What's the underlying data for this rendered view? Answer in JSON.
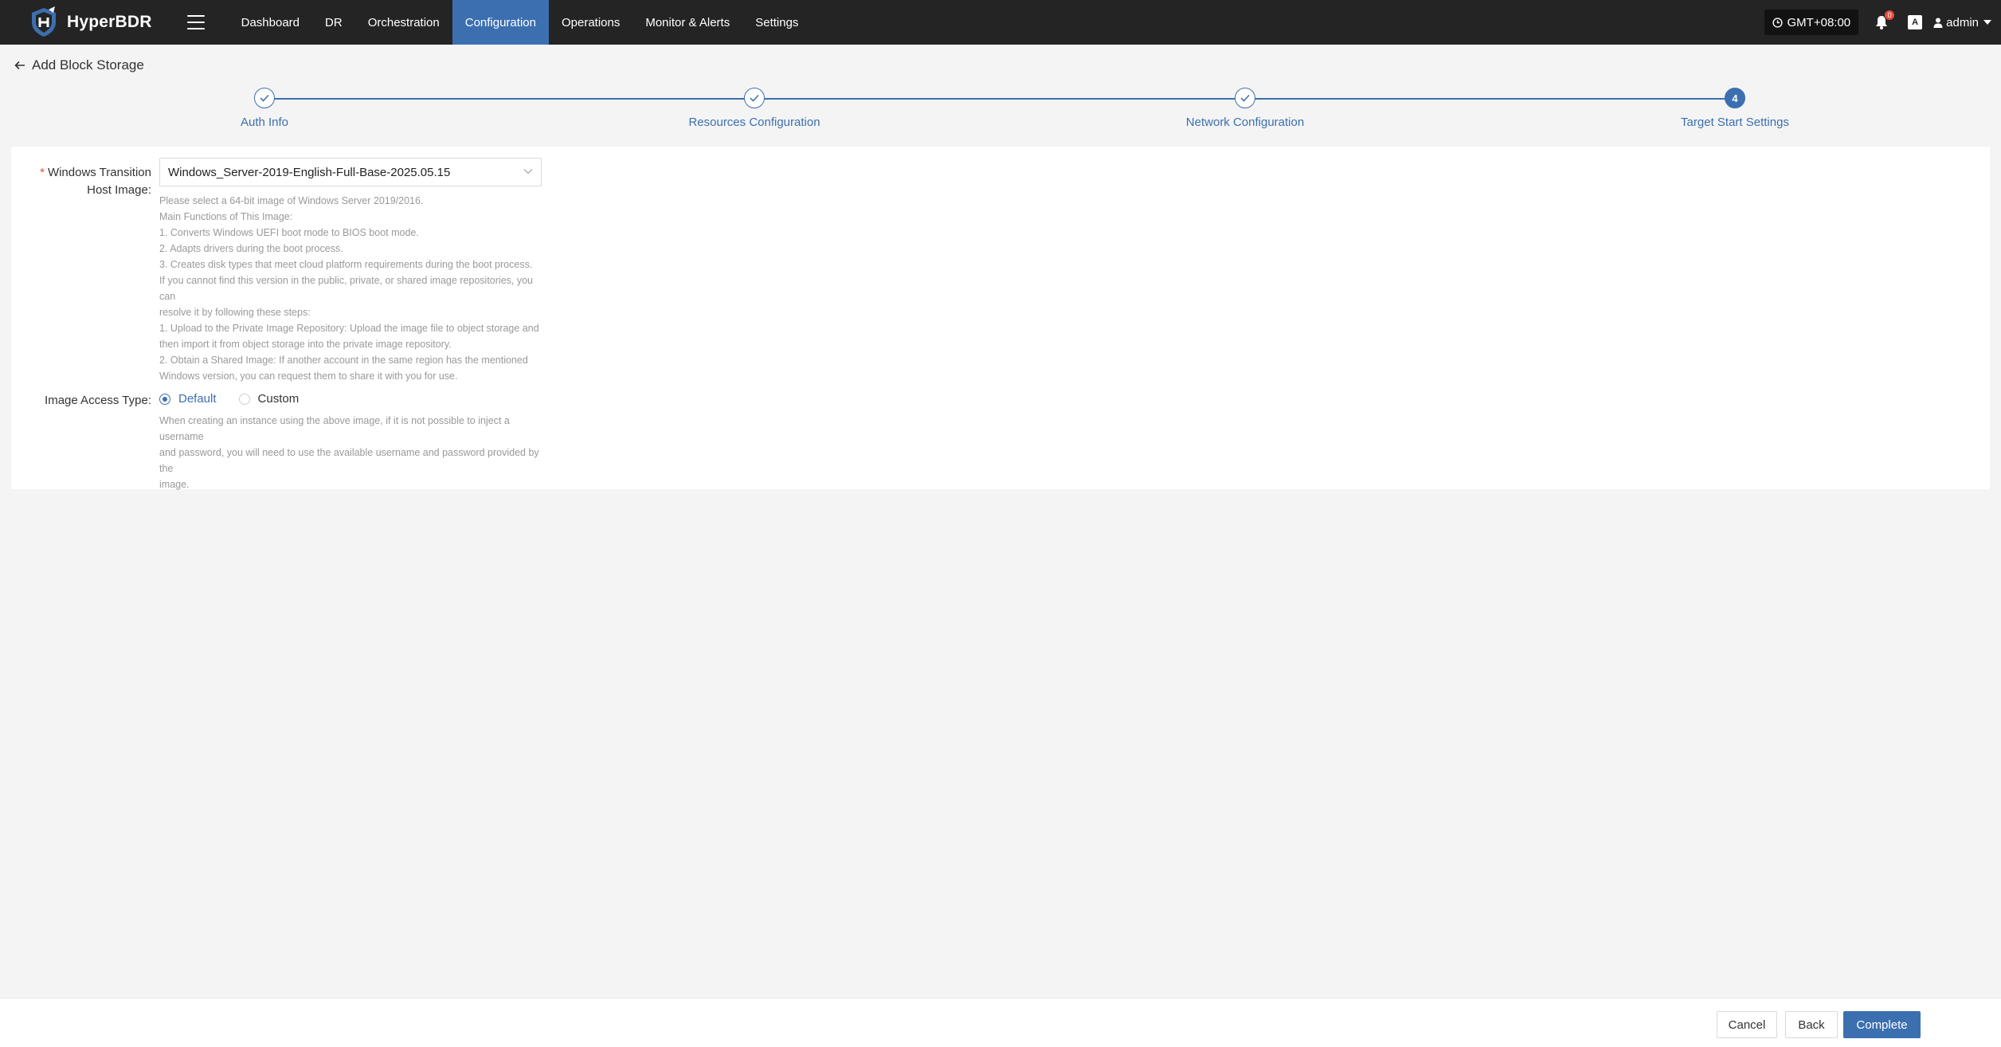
{
  "app": {
    "brand": "HyperBDR"
  },
  "nav": [
    {
      "label": "Dashboard",
      "active": false
    },
    {
      "label": "DR",
      "active": false
    },
    {
      "label": "Orchestration",
      "active": false
    },
    {
      "label": "Configuration",
      "active": true
    },
    {
      "label": "Operations",
      "active": false
    },
    {
      "label": "Monitor & Alerts",
      "active": false
    },
    {
      "label": "Settings",
      "active": false
    }
  ],
  "topbar": {
    "timezone": "GMT+08:00",
    "notification_count": "0",
    "lang_icon_text": "A",
    "user": "admin"
  },
  "page": {
    "title": "Add Block Storage"
  },
  "steps": [
    {
      "label": "Auth Info",
      "status": "done",
      "number": "1"
    },
    {
      "label": "Resources Configuration",
      "status": "done",
      "number": "2"
    },
    {
      "label": "Network Configuration",
      "status": "done",
      "number": "3"
    },
    {
      "label": "Target Start Settings",
      "status": "current",
      "number": "4"
    }
  ],
  "form": {
    "image_label_required": "*",
    "image_label_line1": "Windows Transition",
    "image_label_line2": "Host Image:",
    "image_value": "Windows_Server-2019-English-Full-Base-2025.05.15",
    "image_help": [
      "Please select a 64-bit image of Windows Server 2019/2016.",
      "Main Functions of This Image:",
      "1. Converts Windows UEFI boot mode to BIOS boot mode.",
      "2. Adapts drivers during the boot process.",
      "3. Creates disk types that meet cloud platform requirements during the boot process.",
      "If you cannot find this version in the public, private, or shared image repositories, you can",
      "resolve it by following these steps:",
      "1. Upload to the Private Image Repository: Upload the image file to object storage and",
      "then import it from object storage into the private image repository.",
      "2. Obtain a Shared Image: If another account in the same region has the mentioned",
      "Windows version, you can request them to share it with you for use."
    ],
    "access_label": "Image Access Type:",
    "access_options": [
      {
        "label": "Default",
        "checked": true
      },
      {
        "label": "Custom",
        "checked": false
      }
    ],
    "access_help": [
      "When creating an instance using the above image, if it is not possible to inject a username",
      "and password, you will need to use the available username and password provided by the",
      "image."
    ]
  },
  "footer": {
    "cancel": "Cancel",
    "back": "Back",
    "complete": "Complete"
  },
  "colors": {
    "accent": "#3c6fb0",
    "topbar": "#242424",
    "page_bg": "#f4f4f4"
  }
}
